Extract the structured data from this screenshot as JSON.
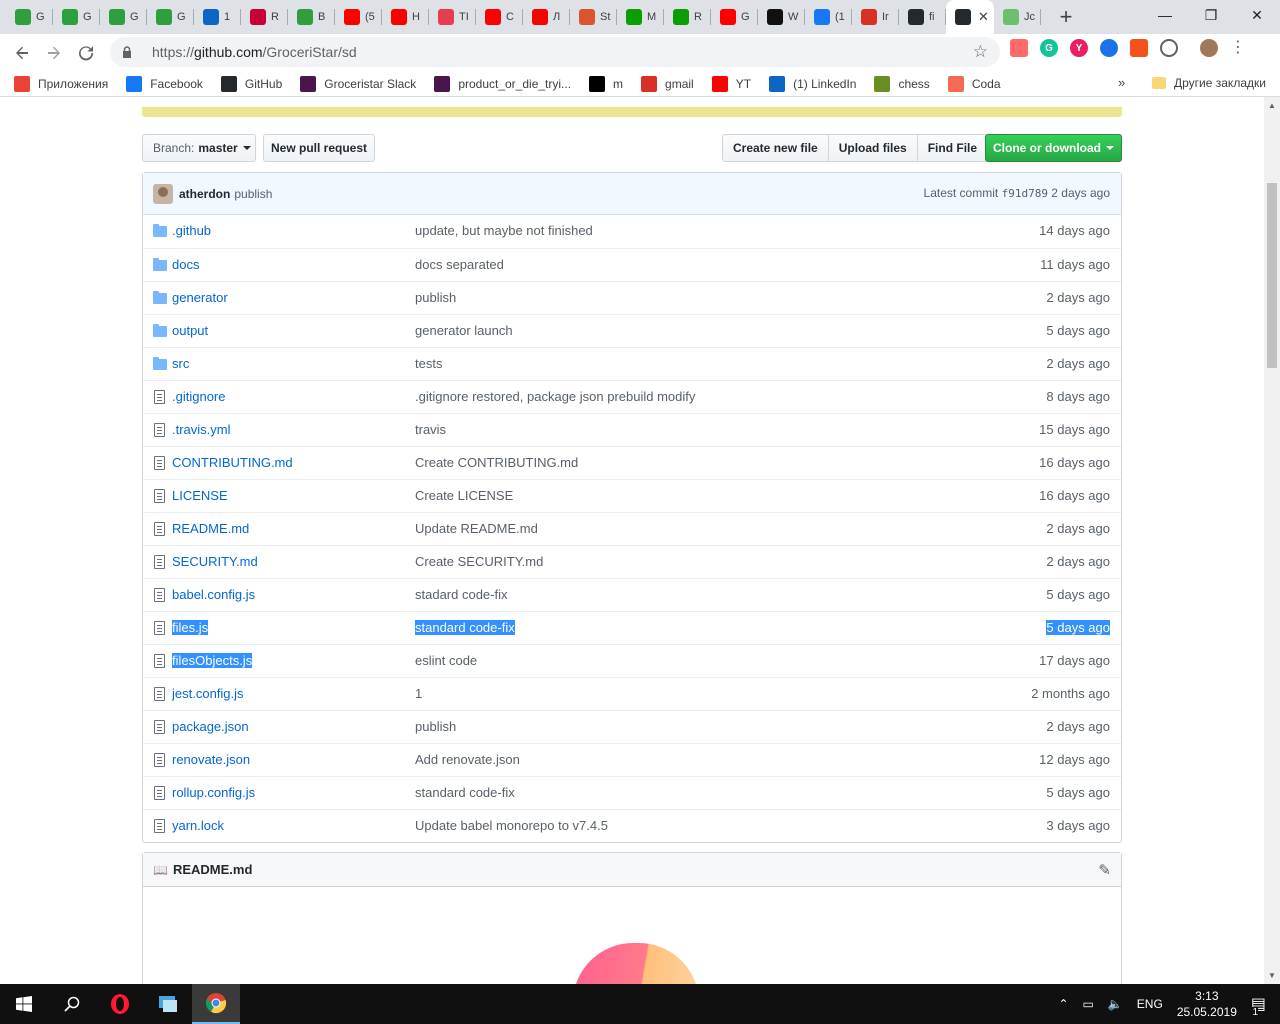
{
  "browser": {
    "tabs": [
      {
        "label": "G",
        "icon": "green-logo-icon",
        "color": "#2e9e3e"
      },
      {
        "label": "G",
        "icon": "green-logo-icon",
        "color": "#2e9e3e"
      },
      {
        "label": "G",
        "icon": "green-logo-icon",
        "color": "#2e9e3e"
      },
      {
        "label": "G",
        "icon": "green-logo-icon",
        "color": "#2e9e3e"
      },
      {
        "label": "1",
        "icon": "linkedin-icon",
        "color": "#0a66c2"
      },
      {
        "label": "R",
        "icon": "debian-icon",
        "color": "#c70036"
      },
      {
        "label": "B",
        "icon": "green-logo-icon",
        "color": "#2e9e3e"
      },
      {
        "label": "(5",
        "icon": "youtube-icon",
        "color": "#ff0000"
      },
      {
        "label": "H",
        "icon": "youtube-icon",
        "color": "#ff0000"
      },
      {
        "label": "TI",
        "icon": "fyi-icon",
        "color": "#e53e51"
      },
      {
        "label": "C",
        "icon": "youtube-icon",
        "color": "#ff0000"
      },
      {
        "label": "Л",
        "icon": "youtube-icon",
        "color": "#ff0000"
      },
      {
        "label": "St",
        "icon": "producthunt-icon",
        "color": "#da552f"
      },
      {
        "label": "M",
        "icon": "techcrunch-icon",
        "color": "#0a9e01"
      },
      {
        "label": "R",
        "icon": "techcrunch-icon",
        "color": "#0a9e01"
      },
      {
        "label": "G",
        "icon": "youtube-icon",
        "color": "#ff0000"
      },
      {
        "label": "W",
        "icon": "ih-icon",
        "color": "#111111"
      },
      {
        "label": "(1",
        "icon": "facebook-icon",
        "color": "#1877f2"
      },
      {
        "label": "Ir",
        "icon": "gmail-icon",
        "color": "#d93025"
      },
      {
        "label": "fi",
        "icon": "github-icon",
        "color": "#24292e"
      },
      {
        "label": "",
        "icon": "github-icon",
        "color": "#24292e",
        "active": true
      },
      {
        "label": "Jc",
        "icon": "chess-icon",
        "color": "#6cbf6c"
      }
    ],
    "url_prefix": "https://",
    "url_host": "github.com",
    "url_path": "/GroceriStar/sd",
    "close_glyph": "✕",
    "new_tab_glyph": "+",
    "window_controls": [
      "—",
      "❐",
      "✕"
    ]
  },
  "bookmarks": {
    "items": [
      {
        "label": "Приложения",
        "icon": "apps-grid-icon",
        "color": "#ea4335"
      },
      {
        "label": "Facebook",
        "icon": "facebook-icon",
        "color": "#1877f2"
      },
      {
        "label": "GitHub",
        "icon": "github-icon",
        "color": "#24292e"
      },
      {
        "label": "Groceristar Slack",
        "icon": "slack-icon",
        "color": "#4a154b"
      },
      {
        "label": "product_or_die_tryi...",
        "icon": "slack-icon",
        "color": "#4a154b"
      },
      {
        "label": "m",
        "icon": "medium-icon",
        "color": "#000000"
      },
      {
        "label": "gmail",
        "icon": "gmail-icon",
        "color": "#d93025"
      },
      {
        "label": "YT",
        "icon": "youtube-icon",
        "color": "#ff0000"
      },
      {
        "label": "(1) LinkedIn",
        "icon": "linkedin-icon",
        "color": "#0a66c2"
      },
      {
        "label": "chess",
        "icon": "chess-pawn-icon",
        "color": "#6b8e23"
      },
      {
        "label": "Coda",
        "icon": "coda-icon",
        "color": "#f46a54"
      }
    ],
    "more": "»",
    "other": "Другие закладки"
  },
  "repo": {
    "branch_label": "Branch:",
    "branch_name": "master",
    "new_pr": "New pull request",
    "create_file": "Create new file",
    "upload_files": "Upload files",
    "find_file": "Find File",
    "clone": "Clone or download",
    "commit": {
      "author": "atherdon",
      "message": "publish",
      "latest_label": "Latest commit",
      "sha": "f91d789",
      "age": "2 days ago"
    },
    "files": [
      {
        "name": ".github",
        "type": "dir",
        "message": "update, but maybe not finished",
        "age": "14 days ago"
      },
      {
        "name": "docs",
        "type": "dir",
        "message": "docs separated",
        "age": "11 days ago"
      },
      {
        "name": "generator",
        "type": "dir",
        "message": "publish",
        "age": "2 days ago"
      },
      {
        "name": "output",
        "type": "dir",
        "message": "generator launch",
        "age": "5 days ago"
      },
      {
        "name": "src",
        "type": "dir",
        "message": "tests",
        "age": "2 days ago"
      },
      {
        "name": ".gitignore",
        "type": "file",
        "message": ".gitignore restored, package json prebuild modify",
        "age": "8 days ago"
      },
      {
        "name": ".travis.yml",
        "type": "file",
        "message": "travis",
        "age": "15 days ago"
      },
      {
        "name": "CONTRIBUTING.md",
        "type": "file",
        "message": "Create CONTRIBUTING.md",
        "age": "16 days ago"
      },
      {
        "name": "LICENSE",
        "type": "file",
        "message": "Create LICENSE",
        "age": "16 days ago"
      },
      {
        "name": "README.md",
        "type": "file",
        "message": "Update README.md",
        "age": "2 days ago"
      },
      {
        "name": "SECURITY.md",
        "type": "file",
        "message": "Create SECURITY.md",
        "age": "2 days ago"
      },
      {
        "name": "babel.config.js",
        "type": "file",
        "message": "stadard code-fix",
        "age": "5 days ago"
      },
      {
        "name": "files.js",
        "type": "file",
        "message": "standard code-fix",
        "age": "5 days ago",
        "selected": "all"
      },
      {
        "name": "filesObjects.js",
        "type": "file",
        "message": "eslint code",
        "age": "17 days ago",
        "selected": "name"
      },
      {
        "name": "jest.config.js",
        "type": "file",
        "message": "1",
        "age": "2 months ago"
      },
      {
        "name": "package.json",
        "type": "file",
        "message": "publish",
        "age": "2 days ago"
      },
      {
        "name": "renovate.json",
        "type": "file",
        "message": "Add renovate.json",
        "age": "12 days ago"
      },
      {
        "name": "rollup.config.js",
        "type": "file",
        "message": "standard code-fix",
        "age": "5 days ago"
      },
      {
        "name": "yarn.lock",
        "type": "file",
        "message": "Update babel monorepo to v7.4.5",
        "age": "3 days ago"
      }
    ],
    "readme_title": "README.md"
  },
  "taskbar": {
    "lang": "ENG",
    "time": "3:13",
    "date": "25.05.2019",
    "notifications": "1"
  },
  "colors": {
    "link": "#0366d6",
    "selection": "#3390ff",
    "clone_green": "#28a745",
    "banner_yellow": "#ece78f"
  }
}
